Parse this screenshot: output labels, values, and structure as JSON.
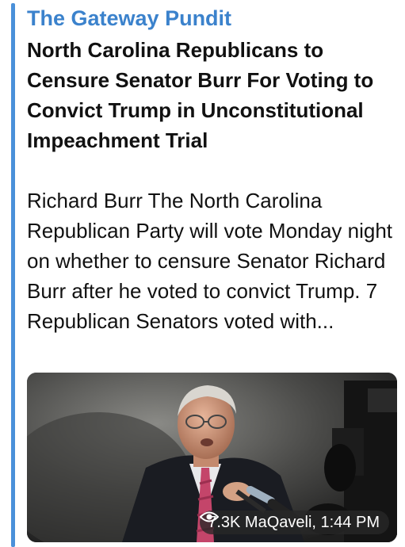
{
  "post": {
    "source": "The Gateway Pundit",
    "headline": "North Carolina Republicans to Censure Senator Burr For Voting to Convict Trump in Unconstitutional Impeachment Trial",
    "summary": "Richard Burr The North Carolina Republican Party will vote Monday night on whether to censure Senator Richard Burr after he voted to convict Trump. 7 Republican Senators voted with...",
    "views": "7.3K",
    "author": "MaQaveli",
    "time": "1:44 PM",
    "meta_text": "7.3K MaQaveli, 1:44 PM"
  },
  "media": {
    "kind": "photo",
    "description_icon": "photo-of-senator-with-microphones"
  },
  "colors": {
    "accent": "#4a90d9",
    "source": "#3b82cc",
    "text": "#111111"
  },
  "icons": {
    "views": "eye-icon"
  }
}
